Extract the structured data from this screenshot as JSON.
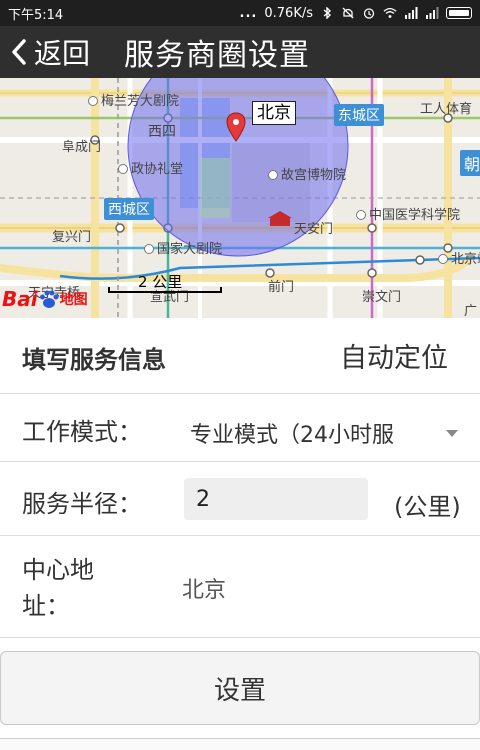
{
  "status_bar": {
    "time": "下午5:14",
    "dots": "...",
    "speed": "0.76K/s"
  },
  "title_bar": {
    "back_label": "返回",
    "title": "服务商圈设置"
  },
  "map": {
    "callout": "北京",
    "scale": "2 公里",
    "logo_bai": "Bai",
    "logo_du": "地图",
    "labels": {
      "meilanfang": "梅兰芳大剧院",
      "xisi": "西四",
      "dongcheng": "东城区",
      "gongren": "工人体育",
      "fuchengmen": "阜成门",
      "zhengxie": "政协礼堂",
      "gugong": "故宫博物院",
      "chao": "朝",
      "xicheng": "西城区",
      "tiananmen": "天安门",
      "yixue": "中国医学科学院",
      "fuxingmen": "复兴门",
      "dajuyuan": "国家大剧院",
      "beijingzhan": "北京站",
      "tianningsi": "天宁寺桥",
      "xuanwumen": "宣武门",
      "qianmen": "前门",
      "chongwenmen": "崇文门",
      "guang": "广"
    }
  },
  "form": {
    "section_title": "填写服务信息",
    "auto_locate": "自动定位",
    "mode_label": "工作模式：",
    "mode_value": "专业模式（24小时服",
    "radius_label": "服务半径：",
    "radius_value": "2",
    "radius_unit": "(公里)",
    "address_label": "中心地址：",
    "address_value": "北京",
    "submit": "设置"
  },
  "colors": {
    "title_bar": "#2f2f2f",
    "status_bar": "#1f1f1f",
    "service_circle": "#6e6ef0",
    "district_label": "#3d8fd6"
  }
}
